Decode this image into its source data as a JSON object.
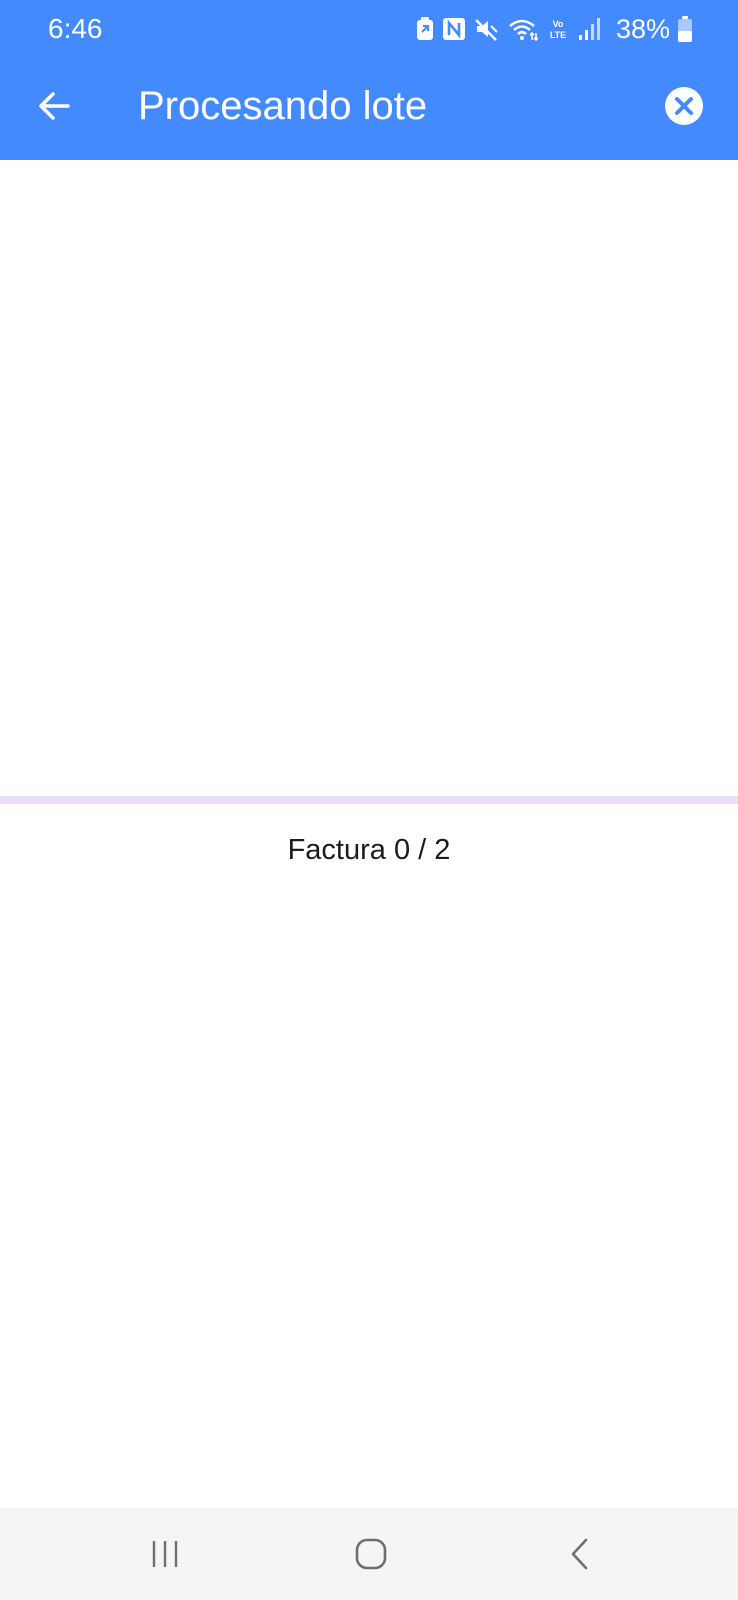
{
  "status_bar": {
    "time": "6:46",
    "battery_percent": "38%",
    "icons": [
      "battery-saver-icon",
      "nfc-icon",
      "mute-icon",
      "wifi-icon",
      "volte-icon",
      "signal-icon",
      "battery-icon"
    ]
  },
  "app_bar": {
    "title": "Procesando lote",
    "back_icon": "arrow-back-icon",
    "cancel_icon": "cancel-circle-icon"
  },
  "progress": {
    "value": 0,
    "label": "Factura 0 / 2"
  },
  "nav_bar": {
    "icons": [
      "recents-icon",
      "home-icon",
      "back-chevron-icon"
    ]
  },
  "colors": {
    "primary": "#448aff",
    "progress_track": "#e8def8",
    "progress_fill": "#6750a4",
    "text": "#1d1b20",
    "nav_background": "#f5f5f7"
  }
}
